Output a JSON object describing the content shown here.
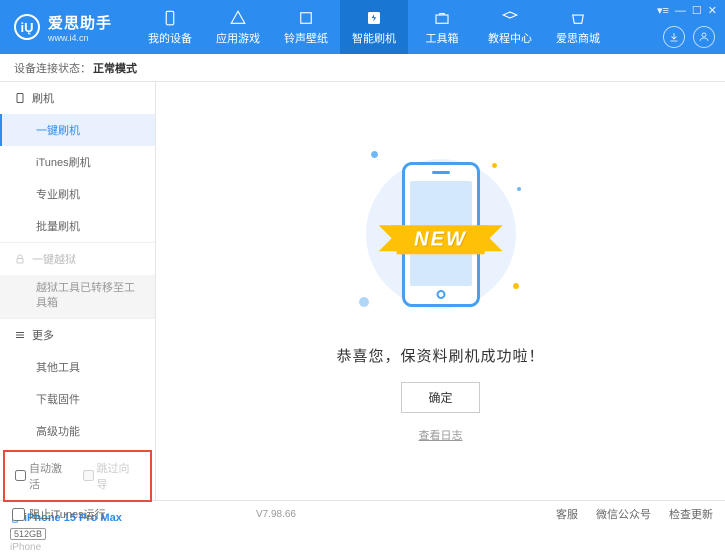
{
  "header": {
    "brand": "爱思助手",
    "url": "www.i4.cn",
    "nav": [
      {
        "label": "我的设备"
      },
      {
        "label": "应用游戏"
      },
      {
        "label": "铃声壁纸"
      },
      {
        "label": "智能刷机"
      },
      {
        "label": "工具箱"
      },
      {
        "label": "教程中心"
      },
      {
        "label": "爱思商城"
      }
    ]
  },
  "status": {
    "label": "设备连接状态：",
    "mode": "正常模式"
  },
  "sidebar": {
    "flash": {
      "head": "刷机",
      "items": [
        "一键刷机",
        "iTunes刷机",
        "专业刷机",
        "批量刷机"
      ]
    },
    "jailbreak": {
      "head": "一键越狱",
      "note": "越狱工具已转移至工具箱"
    },
    "more": {
      "head": "更多",
      "items": [
        "其他工具",
        "下载固件",
        "高级功能"
      ]
    },
    "checks": {
      "auto_activate": "自动激活",
      "skip_guide": "跳过向导"
    },
    "device": {
      "name": "iPhone 15 Pro Max",
      "storage": "512GB",
      "type": "iPhone"
    }
  },
  "main": {
    "ribbon": "NEW",
    "success": "恭喜您，保资料刷机成功啦！",
    "ok": "确定",
    "log": "查看日志"
  },
  "footer": {
    "block_itunes": "阻止iTunes运行",
    "version": "V7.98.66",
    "links": [
      "客服",
      "微信公众号",
      "检查更新"
    ]
  }
}
